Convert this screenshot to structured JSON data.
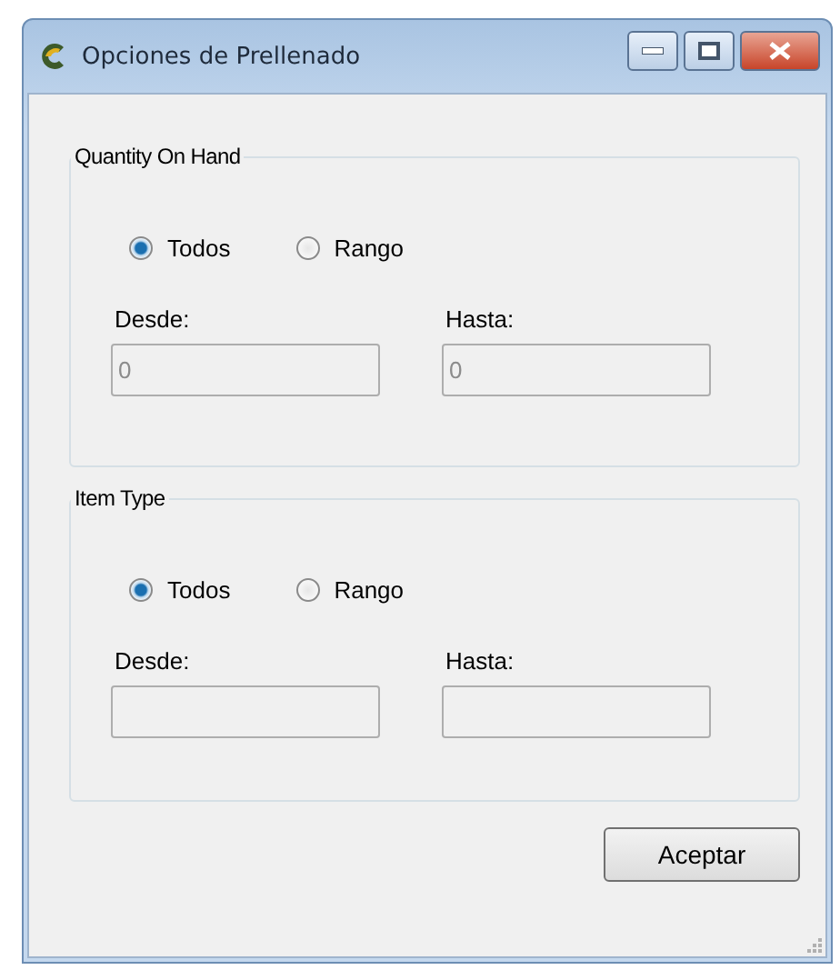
{
  "window": {
    "title": "Opciones de Prellenado"
  },
  "groups": [
    {
      "title": "Quantity On Hand",
      "options": [
        {
          "label": "Todos",
          "selected": true
        },
        {
          "label": "Rango",
          "selected": false
        }
      ],
      "fields": [
        {
          "label": "Desde:",
          "value": "0",
          "disabled": true
        },
        {
          "label": "Hasta:",
          "value": "0",
          "disabled": true
        }
      ]
    },
    {
      "title": "Item Type",
      "options": [
        {
          "label": "Todos",
          "selected": true
        },
        {
          "label": "Rango",
          "selected": false
        }
      ],
      "fields": [
        {
          "label": "Desde:",
          "disabled": true
        },
        {
          "label": "Hasta:",
          "disabled": true
        }
      ]
    }
  ],
  "buttons": [
    "Aceptar"
  ]
}
